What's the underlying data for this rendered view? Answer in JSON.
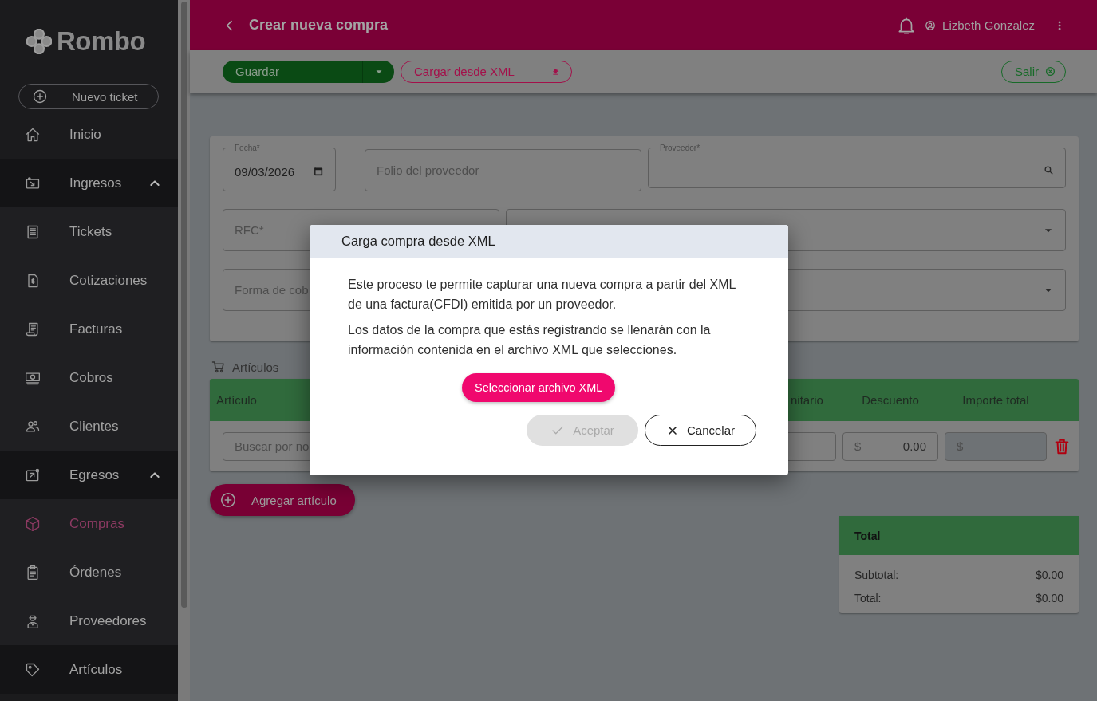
{
  "header": {
    "title": "Crear nueva compra",
    "user": "Lizbeth Gonzalez"
  },
  "sidebar": {
    "logo": "Rombo",
    "new_ticket": "Nuevo ticket",
    "items": [
      {
        "label": "Inicio",
        "kind": "link",
        "selected": false
      },
      {
        "label": "Ingresos",
        "kind": "group",
        "selected": false,
        "expanded": true,
        "children": [
          {
            "label": "Tickets",
            "selected": false
          },
          {
            "label": "Cotizaciones",
            "selected": false
          },
          {
            "label": "Facturas",
            "selected": false
          },
          {
            "label": "Cobros",
            "selected": false
          },
          {
            "label": "Clientes",
            "selected": false
          }
        ]
      },
      {
        "label": "Egresos",
        "kind": "group",
        "selected": false,
        "expanded": true,
        "children": [
          {
            "label": "Compras",
            "selected": true
          },
          {
            "label": "Órdenes",
            "selected": false
          },
          {
            "label": "Proveedores",
            "selected": false
          }
        ]
      },
      {
        "label": "Artículos",
        "kind": "link",
        "selected": false
      }
    ]
  },
  "toolbar": {
    "save": "Guardar",
    "load": "Cargar desde XML",
    "exit": "Salir"
  },
  "form": {
    "date": {
      "label": "Fecha*",
      "value": "09/03/2026"
    },
    "folio": {
      "placeholder": "Folio del proveedor"
    },
    "supplier": {
      "label": "Proveedor*"
    },
    "rfc": {
      "placeholder": "RFC*"
    },
    "payment": {
      "placeholder": "Forma de cob"
    }
  },
  "articles": {
    "title": "Artículos",
    "columns": [
      "Artículo",
      "nitario",
      "Descuento",
      "Importe total"
    ],
    "rows": [
      {
        "search_placeholder": "Buscar por no",
        "discount_symbol": "$",
        "discount": "0.00",
        "total_symbol": "$"
      }
    ],
    "add_button": "Agregar artículo"
  },
  "totals": {
    "title": "Total",
    "rows": [
      {
        "label": "Subtotal:",
        "value": "$0.00"
      },
      {
        "label": "Total:",
        "value": "$0.00"
      }
    ]
  },
  "dialog": {
    "title": "Carga compra desde XML",
    "paragraphs": [
      "Este proceso te permite capturar una nueva compra a partir del XML de una factura(CFDI) emitida por un proveedor.",
      "Los datos de la compra que estás registrando se llenarán con la información contenida en el archivo XML que selecciones."
    ],
    "select_button": "Seleccionar archivo XML",
    "accept": {
      "label": "Aceptar",
      "disabled": true
    },
    "cancel": "Cancelar"
  }
}
